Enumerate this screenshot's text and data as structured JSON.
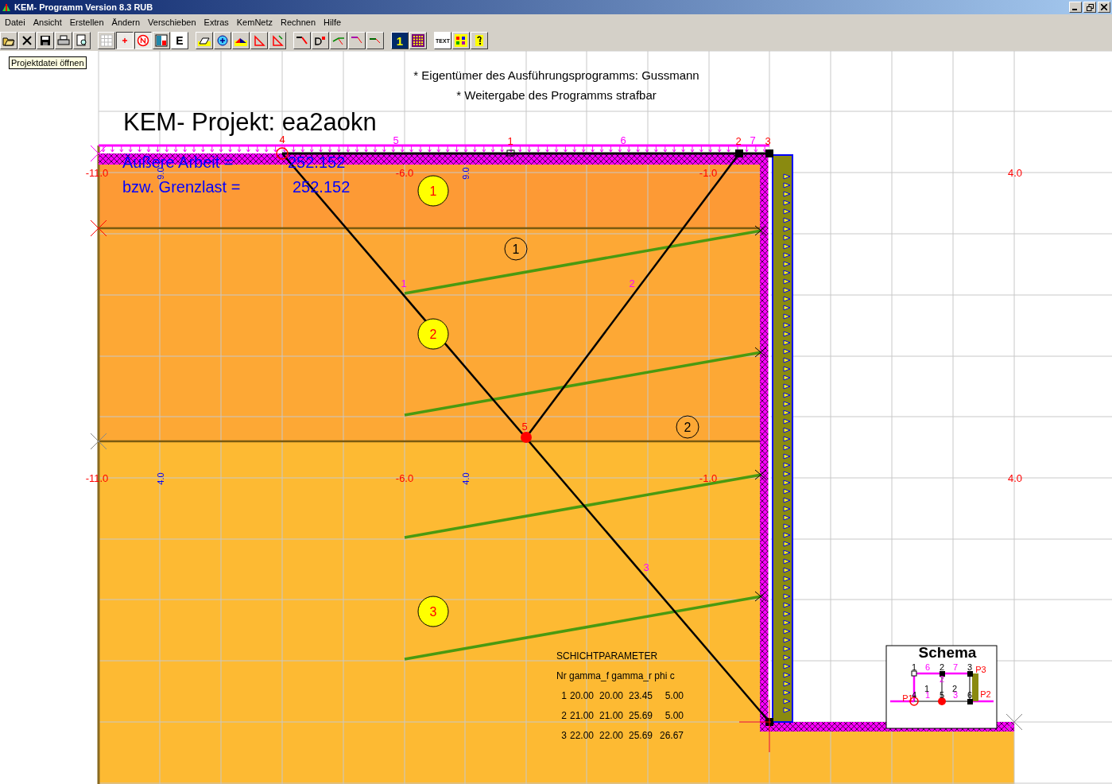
{
  "window": {
    "title": "KEM- Programm Version 8.3 RUB"
  },
  "menu": [
    "Datei",
    "Ansicht",
    "Erstellen",
    "Ändern",
    "Verschieben",
    "Extras",
    "KemNetz",
    "Rechnen",
    "Hilfe"
  ],
  "toolbar": {
    "e_button": "E",
    "number_button": "1",
    "text_button": "TEXT"
  },
  "tooltip": "Projektdatei öffnen",
  "notes": [
    "* Eigentümer des Ausführungsprogramms: Gussmann",
    "* Weitergabe des Programms strafbar"
  ],
  "project_title": "KEM- Projekt: ea2aokn",
  "results": [
    {
      "label": "Äußere Arbeit =",
      "value": "252.152"
    },
    {
      "label": "bzw. Grenzlast =",
      "value": "252.152"
    }
  ],
  "canvas_labels": [
    {
      "kind": "coordinate",
      "text": "-11.0"
    },
    {
      "kind": "coordinate",
      "text": "-6.0"
    },
    {
      "kind": "coordinate",
      "text": "-1.0"
    },
    {
      "kind": "coordinate",
      "text": "4.0"
    },
    {
      "kind": "coordinate",
      "text": "-11.0"
    },
    {
      "kind": "coordinate",
      "text": "-6.0"
    },
    {
      "kind": "coordinate",
      "text": "-1.0"
    },
    {
      "kind": "coordinate",
      "text": "4.0"
    },
    {
      "kind": "depth",
      "text": "9.0"
    },
    {
      "kind": "depth",
      "text": "9.0"
    },
    {
      "kind": "depth",
      "text": "4.0"
    },
    {
      "kind": "depth",
      "text": "4.0"
    },
    {
      "kind": "point",
      "text": "4"
    },
    {
      "kind": "segment",
      "text": "5"
    },
    {
      "kind": "point",
      "text": "1"
    },
    {
      "kind": "segment",
      "text": "6"
    },
    {
      "kind": "point",
      "text": "2"
    },
    {
      "kind": "segment",
      "text": "7"
    },
    {
      "kind": "point",
      "text": "3"
    },
    {
      "kind": "point",
      "text": "5"
    },
    {
      "kind": "segment",
      "text": "1"
    },
    {
      "kind": "segment",
      "text": "2"
    },
    {
      "kind": "segment",
      "text": "3"
    }
  ],
  "layers": [
    {
      "kind": "filled",
      "text": "1"
    },
    {
      "kind": "filled",
      "text": "2"
    },
    {
      "kind": "filled",
      "text": "3"
    },
    {
      "kind": "outlined",
      "text": "1"
    },
    {
      "kind": "outlined",
      "text": "2"
    }
  ],
  "table": {
    "title": "SCHICHTPARAMETER",
    "header": "Nr gamma_f gamma_r phi c",
    "rows": [
      [
        "1",
        "20.00",
        "20.00",
        "23.45",
        "5.00"
      ],
      [
        "2",
        "21.00",
        "21.00",
        "25.69",
        "5.00"
      ],
      [
        "3",
        "22.00",
        "22.00",
        "25.69",
        "26.67"
      ]
    ]
  },
  "schema": {
    "title": "Schema",
    "labels": [
      {
        "kind": "node",
        "text": "1"
      },
      {
        "kind": "segment",
        "text": "6"
      },
      {
        "kind": "node",
        "text": "2"
      },
      {
        "kind": "segment",
        "text": "7"
      },
      {
        "kind": "node",
        "text": "3"
      },
      {
        "kind": "support",
        "text": "P3"
      },
      {
        "kind": "segment",
        "text": "2"
      },
      {
        "kind": "node",
        "text": "1"
      },
      {
        "kind": "node",
        "text": "2"
      },
      {
        "kind": "support",
        "text": "P1"
      },
      {
        "kind": "node",
        "text": "4"
      },
      {
        "kind": "segment",
        "text": "1"
      },
      {
        "kind": "node",
        "text": "5"
      },
      {
        "kind": "segment",
        "text": "3"
      },
      {
        "kind": "node",
        "text": "6"
      },
      {
        "kind": "support",
        "text": "P2"
      }
    ]
  }
}
